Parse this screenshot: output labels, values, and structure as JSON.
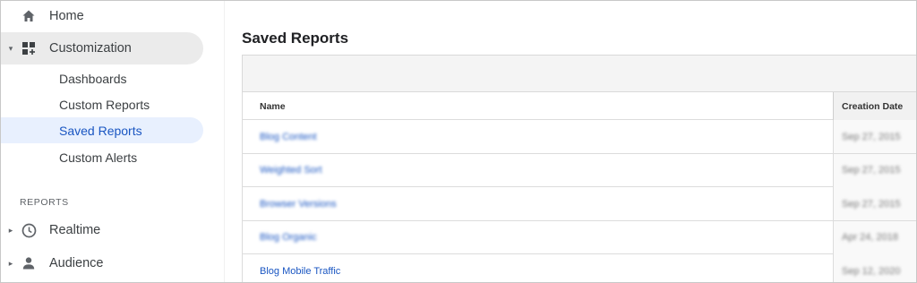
{
  "sidebar": {
    "home": {
      "label": "Home",
      "icon": "home-icon"
    },
    "customization": {
      "label": "Customization",
      "icon": "dashboard-add-icon",
      "caret": "▾",
      "items": [
        {
          "label": "Dashboards"
        },
        {
          "label": "Custom Reports"
        },
        {
          "label": "Saved Reports",
          "active": true
        },
        {
          "label": "Custom Alerts"
        }
      ]
    },
    "reports_heading": "REPORTS",
    "realtime": {
      "label": "Realtime",
      "icon": "clock-icon",
      "caret": "▸"
    },
    "audience": {
      "label": "Audience",
      "icon": "person-icon",
      "caret": "▸"
    }
  },
  "main": {
    "title": "Saved Reports",
    "columns": {
      "name": "Name",
      "date": "Creation Date"
    },
    "rows": [
      {
        "name": "Blog Content",
        "date": "Sep 27, 2015",
        "blurred": true
      },
      {
        "name": "Weighted Sort",
        "date": "Sep 27, 2015",
        "blurred": true
      },
      {
        "name": "Browser Versions",
        "date": "Sep 27, 2015",
        "blurred": true
      },
      {
        "name": "Blog Organic",
        "date": "Apr 24, 2018",
        "blurred": true
      },
      {
        "name": "Blog Mobile Traffic",
        "date": "Sep 12, 2020",
        "blurred": false
      }
    ]
  },
  "colors": {
    "accent": "#1a56c2",
    "active_bg": "#e8f0fe",
    "expanded_bg": "#ebebeb",
    "icon": "#5f6368"
  }
}
